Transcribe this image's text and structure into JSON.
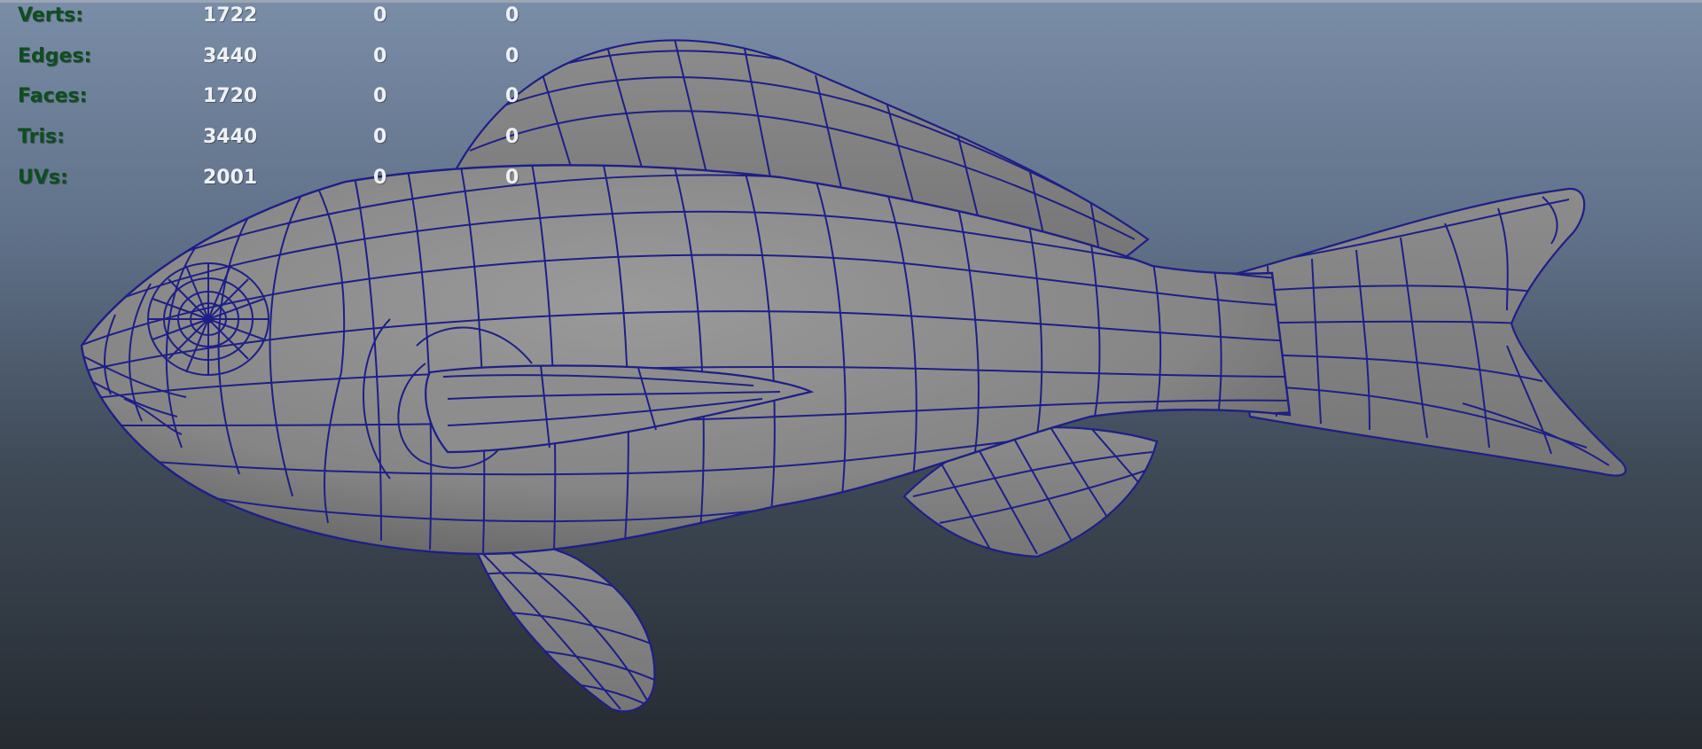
{
  "hud": {
    "rows": [
      {
        "label": "Verts:",
        "total": "1722",
        "selected": "0",
        "third": "0"
      },
      {
        "label": "Edges:",
        "total": "3440",
        "selected": "0",
        "third": "0"
      },
      {
        "label": "Faces:",
        "total": "1720",
        "selected": "0",
        "third": "0"
      },
      {
        "label": "Tris:",
        "total": "3440",
        "selected": "0",
        "third": "0"
      },
      {
        "label": "UVs:",
        "total": "2001",
        "selected": "0",
        "third": "0"
      }
    ]
  },
  "colors": {
    "label": "#0f4d20",
    "value": "#eef1f5",
    "wireframe": "#1e1f86",
    "mesh_fill": "#8a8a8a",
    "background_top": "#7a8da6",
    "background_bottom": "#262b31"
  },
  "viewport": {
    "icon": "fish-mesh-icon"
  }
}
